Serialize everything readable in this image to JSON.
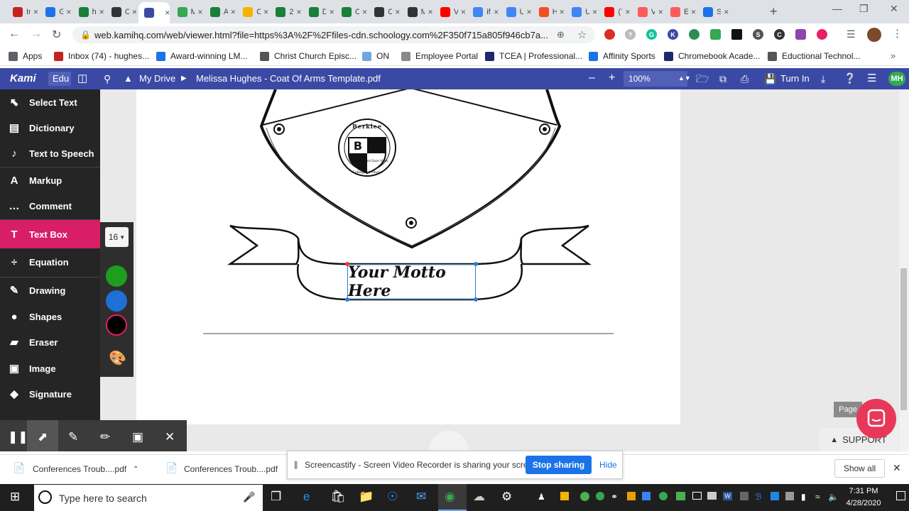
{
  "browser": {
    "tabs": [
      {
        "label": "Inl",
        "icon": "gmail-icon",
        "color": "#c5221f"
      },
      {
        "label": "Gc",
        "icon": "shield-icon",
        "color": "#1a73e8"
      },
      {
        "label": "his",
        "icon": "sheets-icon",
        "color": "#188038"
      },
      {
        "label": "Cc",
        "icon": "schoology-icon",
        "color": "#333333"
      },
      {
        "label": "",
        "icon": "kami-icon",
        "color": "#3a4aa4",
        "active": true
      },
      {
        "label": "M",
        "icon": "drive-icon",
        "color": "#34a853"
      },
      {
        "label": "Al",
        "icon": "sheets-icon",
        "color": "#188038"
      },
      {
        "label": "Cc",
        "icon": "slides-icon",
        "color": "#f4b400"
      },
      {
        "label": "20",
        "icon": "sheets-icon",
        "color": "#188038"
      },
      {
        "label": "Di",
        "icon": "sheets-icon",
        "color": "#188038"
      },
      {
        "label": "CC",
        "icon": "sheets-icon",
        "color": "#188038"
      },
      {
        "label": "Cc",
        "icon": "schoology-icon",
        "color": "#333333"
      },
      {
        "label": "M",
        "icon": "schoology-icon",
        "color": "#333333"
      },
      {
        "label": "Vi",
        "icon": "youtube-icon",
        "color": "#ff0000"
      },
      {
        "label": "if",
        "icon": "google-icon",
        "color": "#4285f4"
      },
      {
        "label": "U:",
        "icon": "google-icon",
        "color": "#4285f4"
      },
      {
        "label": "H",
        "icon": "microsoft-icon",
        "color": "#f25022"
      },
      {
        "label": "U:",
        "icon": "google-icon",
        "color": "#4285f4"
      },
      {
        "label": "(7",
        "icon": "youtube-icon",
        "color": "#ff0000"
      },
      {
        "label": "Vi",
        "icon": "screencastify-icon",
        "color": "#ff5a5a"
      },
      {
        "label": "Ec",
        "icon": "screencastify-icon",
        "color": "#ff5a5a"
      },
      {
        "label": "Se",
        "icon": "gear-icon",
        "color": "#1a73e8"
      }
    ],
    "url": "web.kamihq.com/web/viewer.html?file=https%3A%2F%2Ffiles-cdn.schoology.com%2F350f715a805f946cb7a...",
    "bookmarks": [
      {
        "label": "Apps",
        "color": "#5f6368"
      },
      {
        "label": "Inbox (74) - hughes...",
        "color": "#c5221f"
      },
      {
        "label": "Award-winning LM...",
        "color": "#1a73e8"
      },
      {
        "label": "Christ Church Episc...",
        "color": "#555555"
      },
      {
        "label": "ON",
        "color": "#6fa8dc"
      },
      {
        "label": "Employee Portal",
        "color": "#888888"
      },
      {
        "label": "TCEA | Professional...",
        "color": "#1c2a6b"
      },
      {
        "label": "Affinity Sports",
        "color": "#1a73e8"
      },
      {
        "label": "Chromebook Acade...",
        "color": "#1c2a6b"
      },
      {
        "label": "Eductional Technol...",
        "color": "#555555"
      }
    ]
  },
  "kami": {
    "logo": "Kami",
    "edition": "Edu",
    "breadcrumb_root": "My Drive",
    "document_title": "Melissa Hughes - Coat Of Arms Template.pdf",
    "zoom": "100%",
    "turn_in": "Turn In",
    "avatar": "MH",
    "tools": [
      {
        "label": "Select Text",
        "icon": "cursor-icon"
      },
      {
        "label": "Dictionary",
        "icon": "book-icon"
      },
      {
        "label": "Text to Speech",
        "icon": "speaker-icon"
      },
      {
        "label": "Markup",
        "icon": "markup-icon"
      },
      {
        "label": "Comment",
        "icon": "comment-icon"
      },
      {
        "label": "Text Box",
        "icon": "text-icon",
        "active": true
      },
      {
        "label": "Equation",
        "icon": "divide-icon"
      },
      {
        "label": "Drawing",
        "icon": "brush-icon"
      },
      {
        "label": "Shapes",
        "icon": "shapes-icon"
      },
      {
        "label": "Eraser",
        "icon": "eraser-icon"
      },
      {
        "label": "Image",
        "icon": "image-icon"
      },
      {
        "label": "Signature",
        "icon": "pen-nib-icon"
      }
    ],
    "font_size": "16",
    "colors": [
      "#1e9e1e",
      "#1e6fd6",
      "#000000"
    ],
    "motto_text": "Your Motto Here",
    "crest": {
      "letter": "B",
      "top_text": "Berklee",
      "panel_text": "East Quon Video",
      "bottom_text": "College of Music"
    },
    "page_label": "Page",
    "support": "SUPPORT"
  },
  "screencastify": {
    "notice": "Screencastify - Screen Video Recorder is sharing your screen.",
    "stop": "Stop sharing",
    "hide": "Hide"
  },
  "downloads": {
    "items": [
      "Conferences Troub....pdf",
      "Conferences Troub....pdf"
    ],
    "show_all": "Show all"
  },
  "taskbar": {
    "search_placeholder": "Type here to search",
    "time": "7:31 PM",
    "date": "4/28/2020"
  }
}
